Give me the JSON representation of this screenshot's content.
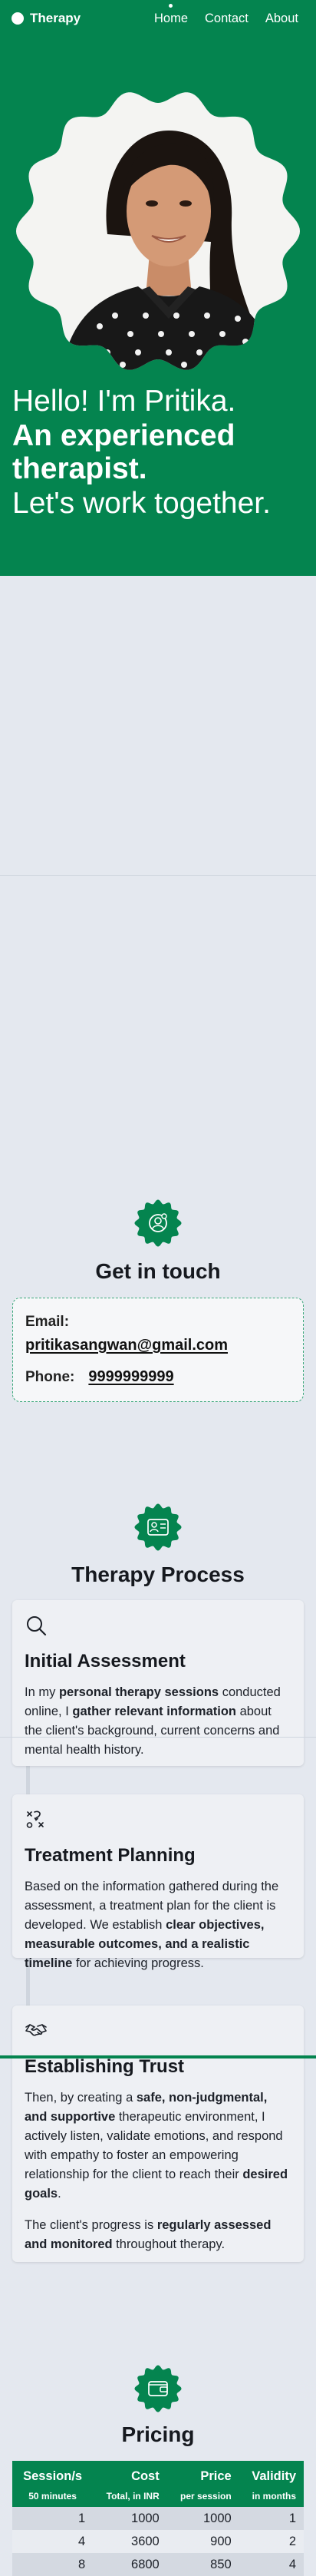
{
  "nav": {
    "brand": "Therapy",
    "links": [
      "Home",
      "Contact",
      "About"
    ],
    "active": "Home"
  },
  "hero": {
    "line1": "Hello! I'm Pritika.",
    "line2a": "An experienced",
    "line2b": "therapist.",
    "line3": "Let's work together."
  },
  "contact": {
    "title": "Get in touch",
    "email_label": "Email:",
    "email": "pritikasangwan@gmail.com",
    "phone_label": "Phone:",
    "phone": "9999999999"
  },
  "process": {
    "title": "Therapy Process",
    "steps": [
      {
        "icon": "search-icon",
        "title": "Initial Assessment",
        "t1": "In my ",
        "b1": "personal therapy sessions",
        "t2": " conducted online, I ",
        "b2": "gather relevant information",
        "t3": " about the client's background, current concerns and mental health history."
      },
      {
        "icon": "treatment-plan-icon",
        "title": "Treatment Planning",
        "t1": "Based on the information gathered during the assessment, a treatment plan for the client is developed. We establish ",
        "b1": "clear objectives, measurable outcomes, and a realistic timeline",
        "t2": " for achieving progress."
      },
      {
        "icon": "handshake-icon",
        "title": "Establishing Trust",
        "t1": "Then, by creating a ",
        "b1": "safe, non-judgmental, and supportive",
        "t2": " therapeutic environment, I actively listen, validate emotions, and respond with empathy to foster an empowering relationship for the client to reach their ",
        "b2": "desired goals",
        "t3": ".",
        "p2_t1": "The client's progress is ",
        "p2_b1": "regularly assessed and monitored",
        "p2_t2": " throughout therapy."
      }
    ]
  },
  "pricing": {
    "title": "Pricing",
    "headers": [
      {
        "main": "Session/s",
        "sub": "50 minutes"
      },
      {
        "main": "Cost",
        "sub": "Total, in INR"
      },
      {
        "main": "Price",
        "sub": "per session"
      },
      {
        "main": "Validity",
        "sub": "in months"
      }
    ],
    "rows": [
      [
        "1",
        "1000",
        "1000",
        "1"
      ],
      [
        "4",
        "3600",
        "900",
        "2"
      ],
      [
        "8",
        "6800",
        "850",
        "4"
      ]
    ]
  },
  "colors": {
    "brand_green": "#04844f",
    "page_bg": "#e4e8ef",
    "card_bg": "#eef0f4"
  }
}
